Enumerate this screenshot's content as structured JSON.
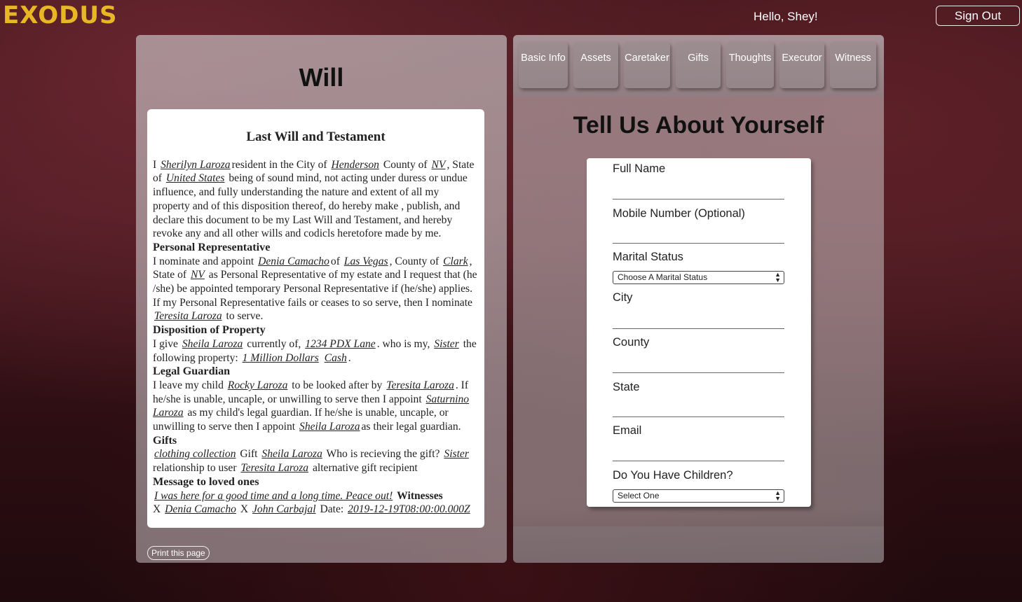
{
  "header": {
    "logo": "EXODUS",
    "greeting": "Hello, Shey!",
    "signout_label": "Sign Out"
  },
  "will": {
    "panel_title": "Will",
    "doc_title": "Last Will and Testament",
    "testator": "Sherilyn Laroza",
    "city": "Henderson",
    "county": "NV",
    "state": "United States",
    "rep_name": "Denia Camacho",
    "rep_city": "Las Vegas",
    "rep_county": "Clark",
    "rep_state": "NV",
    "alt_rep": "Teresita Laroza",
    "gift_recipient": "Sheila Laroza",
    "gift_address": "1234 PDX Lane",
    "gift_relation": "Sister",
    "property_1": "1 Million Dollars",
    "property_2": "Cash",
    "child": "Rocky Laroza",
    "caretaker": "Teresita Laroza",
    "guardian_1": "Saturnino Laroza",
    "guardian_2": "Sheila Laroza",
    "gift_item": "clothing collection",
    "gift_to": "Sheila Laroza",
    "gift_question_answer": "Sister",
    "alt_recipient_user": "Teresita Laroza",
    "message": "I was here for a good time and a long time. Peace out!",
    "witness_1": "Denia Camacho",
    "witness_2": "John Carbajal",
    "date": "2019-12-19T08:00:00.000Z",
    "sections": {
      "personal_rep": "Personal Representative",
      "disposition": "Disposition of Property",
      "guardian": "Legal Guardian",
      "gifts": "Gifts",
      "message": "Message to loved ones",
      "witnesses": "Witnesses"
    },
    "print_label": "Print this page"
  },
  "tabs": [
    "Basic Info",
    "Assets",
    "Caretaker",
    "Gifts",
    "Thoughts",
    "Executor",
    "Witness"
  ],
  "form": {
    "title": "Tell Us About Yourself",
    "full_name": "Full Name",
    "mobile": "Mobile Number (Optional)",
    "marital": "Marital Status",
    "marital_select": "Choose A Marital Status",
    "city": "City",
    "county": "County",
    "state": "State",
    "email": "Email",
    "children": "Do You Have Children?",
    "children_select": "Select One"
  }
}
